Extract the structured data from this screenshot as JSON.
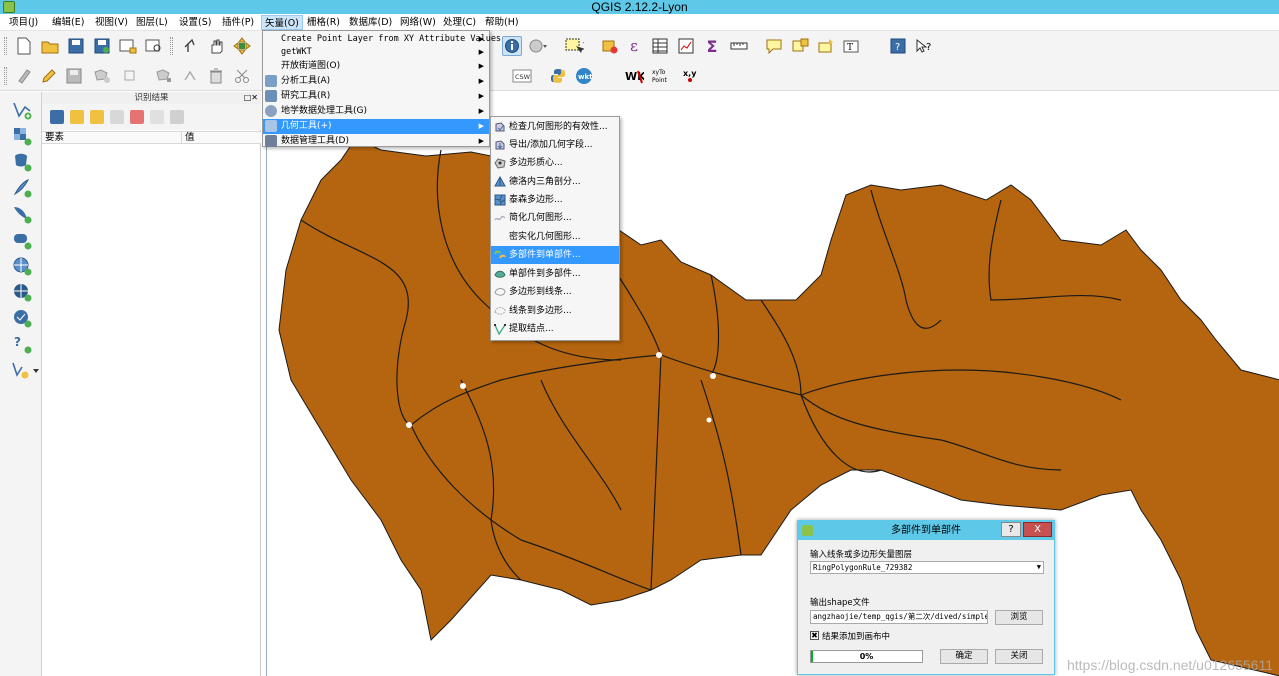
{
  "window": {
    "title": "QGIS 2.12.2-Lyon"
  },
  "menubar": {
    "items": [
      "项目(J)",
      "编辑(E)",
      "视图(V)",
      "图层(L)",
      "设置(S)",
      "插件(P)",
      "矢量(O)",
      "栅格(R)",
      "数据库(D)",
      "网络(W)",
      "处理(C)",
      "帮助(H)"
    ],
    "active": "矢量(O)"
  },
  "vector_menu": {
    "items": [
      {
        "label": "Create Point Layer from XY Attribute Values",
        "submenu": true
      },
      {
        "label": "getWKT",
        "submenu": true
      },
      {
        "label": "开放街道图(O)",
        "submenu": true
      },
      {
        "label": "分析工具(A)",
        "submenu": true,
        "icon": "analysis-tools-icon"
      },
      {
        "label": "研究工具(R)",
        "submenu": true,
        "icon": "research-tools-icon"
      },
      {
        "label": "地学数据处理工具(G)",
        "submenu": true,
        "icon": "geoprocessing-tools-icon"
      },
      {
        "label": "几何工具(+)",
        "submenu": true,
        "icon": "geometry-tools-icon",
        "highlighted": true
      },
      {
        "label": "数据管理工具(D)",
        "submenu": true,
        "icon": "data-management-tools-icon"
      }
    ]
  },
  "geometry_submenu": {
    "items": [
      {
        "label": "检查几何图形的有效性...",
        "icon": "check-validity-icon"
      },
      {
        "label": "导出/添加几何字段...",
        "icon": "export-geometry-columns-icon"
      },
      {
        "label": "多边形质心...",
        "icon": "polygon-centroids-icon"
      },
      {
        "label": "德洛内三角剖分...",
        "icon": "delaunay-icon"
      },
      {
        "label": "泰森多边形...",
        "icon": "voronoi-icon"
      },
      {
        "label": "简化几何图形...",
        "icon": "simplify-icon"
      },
      {
        "label": "密实化几何图形...",
        "icon": "densify-icon"
      },
      {
        "label": "多部件到单部件...",
        "icon": "multipart-to-singleparts-icon",
        "highlighted": true
      },
      {
        "label": "单部件到多部件...",
        "icon": "singleparts-to-multipart-icon"
      },
      {
        "label": "多边形到线条...",
        "icon": "polygons-to-lines-icon"
      },
      {
        "label": "线条到多边形...",
        "icon": "lines-to-polygons-icon"
      },
      {
        "label": "提取结点...",
        "icon": "extract-nodes-icon"
      }
    ]
  },
  "identify_panel": {
    "title": "识别结果",
    "columns": [
      "要素",
      "值"
    ]
  },
  "toolbar": {
    "csw_label": "CSW",
    "wkt_label": "wkt",
    "wkt_caps": "WKT",
    "xytopoint_line1": "xyTo",
    "xytopoint_line2": "Point",
    "xy_label": "x,y"
  },
  "dialog": {
    "title": "多部件到单部件",
    "help_label": "?",
    "close_label": "X",
    "input_label": "输入线条或多边形矢量图层",
    "input_value": "RingPolygonRule_729382",
    "output_label": "输出shape文件",
    "output_value": "angzhaojie/temp_qgis/第二次/dived/simple.shp",
    "browse_label": "浏览",
    "add_to_canvas_label": "结果添加到画布中",
    "add_to_canvas_checked": true,
    "progress": 0,
    "progress_text": "0%",
    "ok_label": "确定",
    "close_button_label": "关闭"
  },
  "watermark": "https://blog.csdn.net/u012655611",
  "colors": {
    "titlebar": "#5ec8e8",
    "map_fill": "#b5650f",
    "map_stroke": "#1a1a1a",
    "menu_highlight": "#3399ff",
    "progress_fill": "#06b025"
  }
}
